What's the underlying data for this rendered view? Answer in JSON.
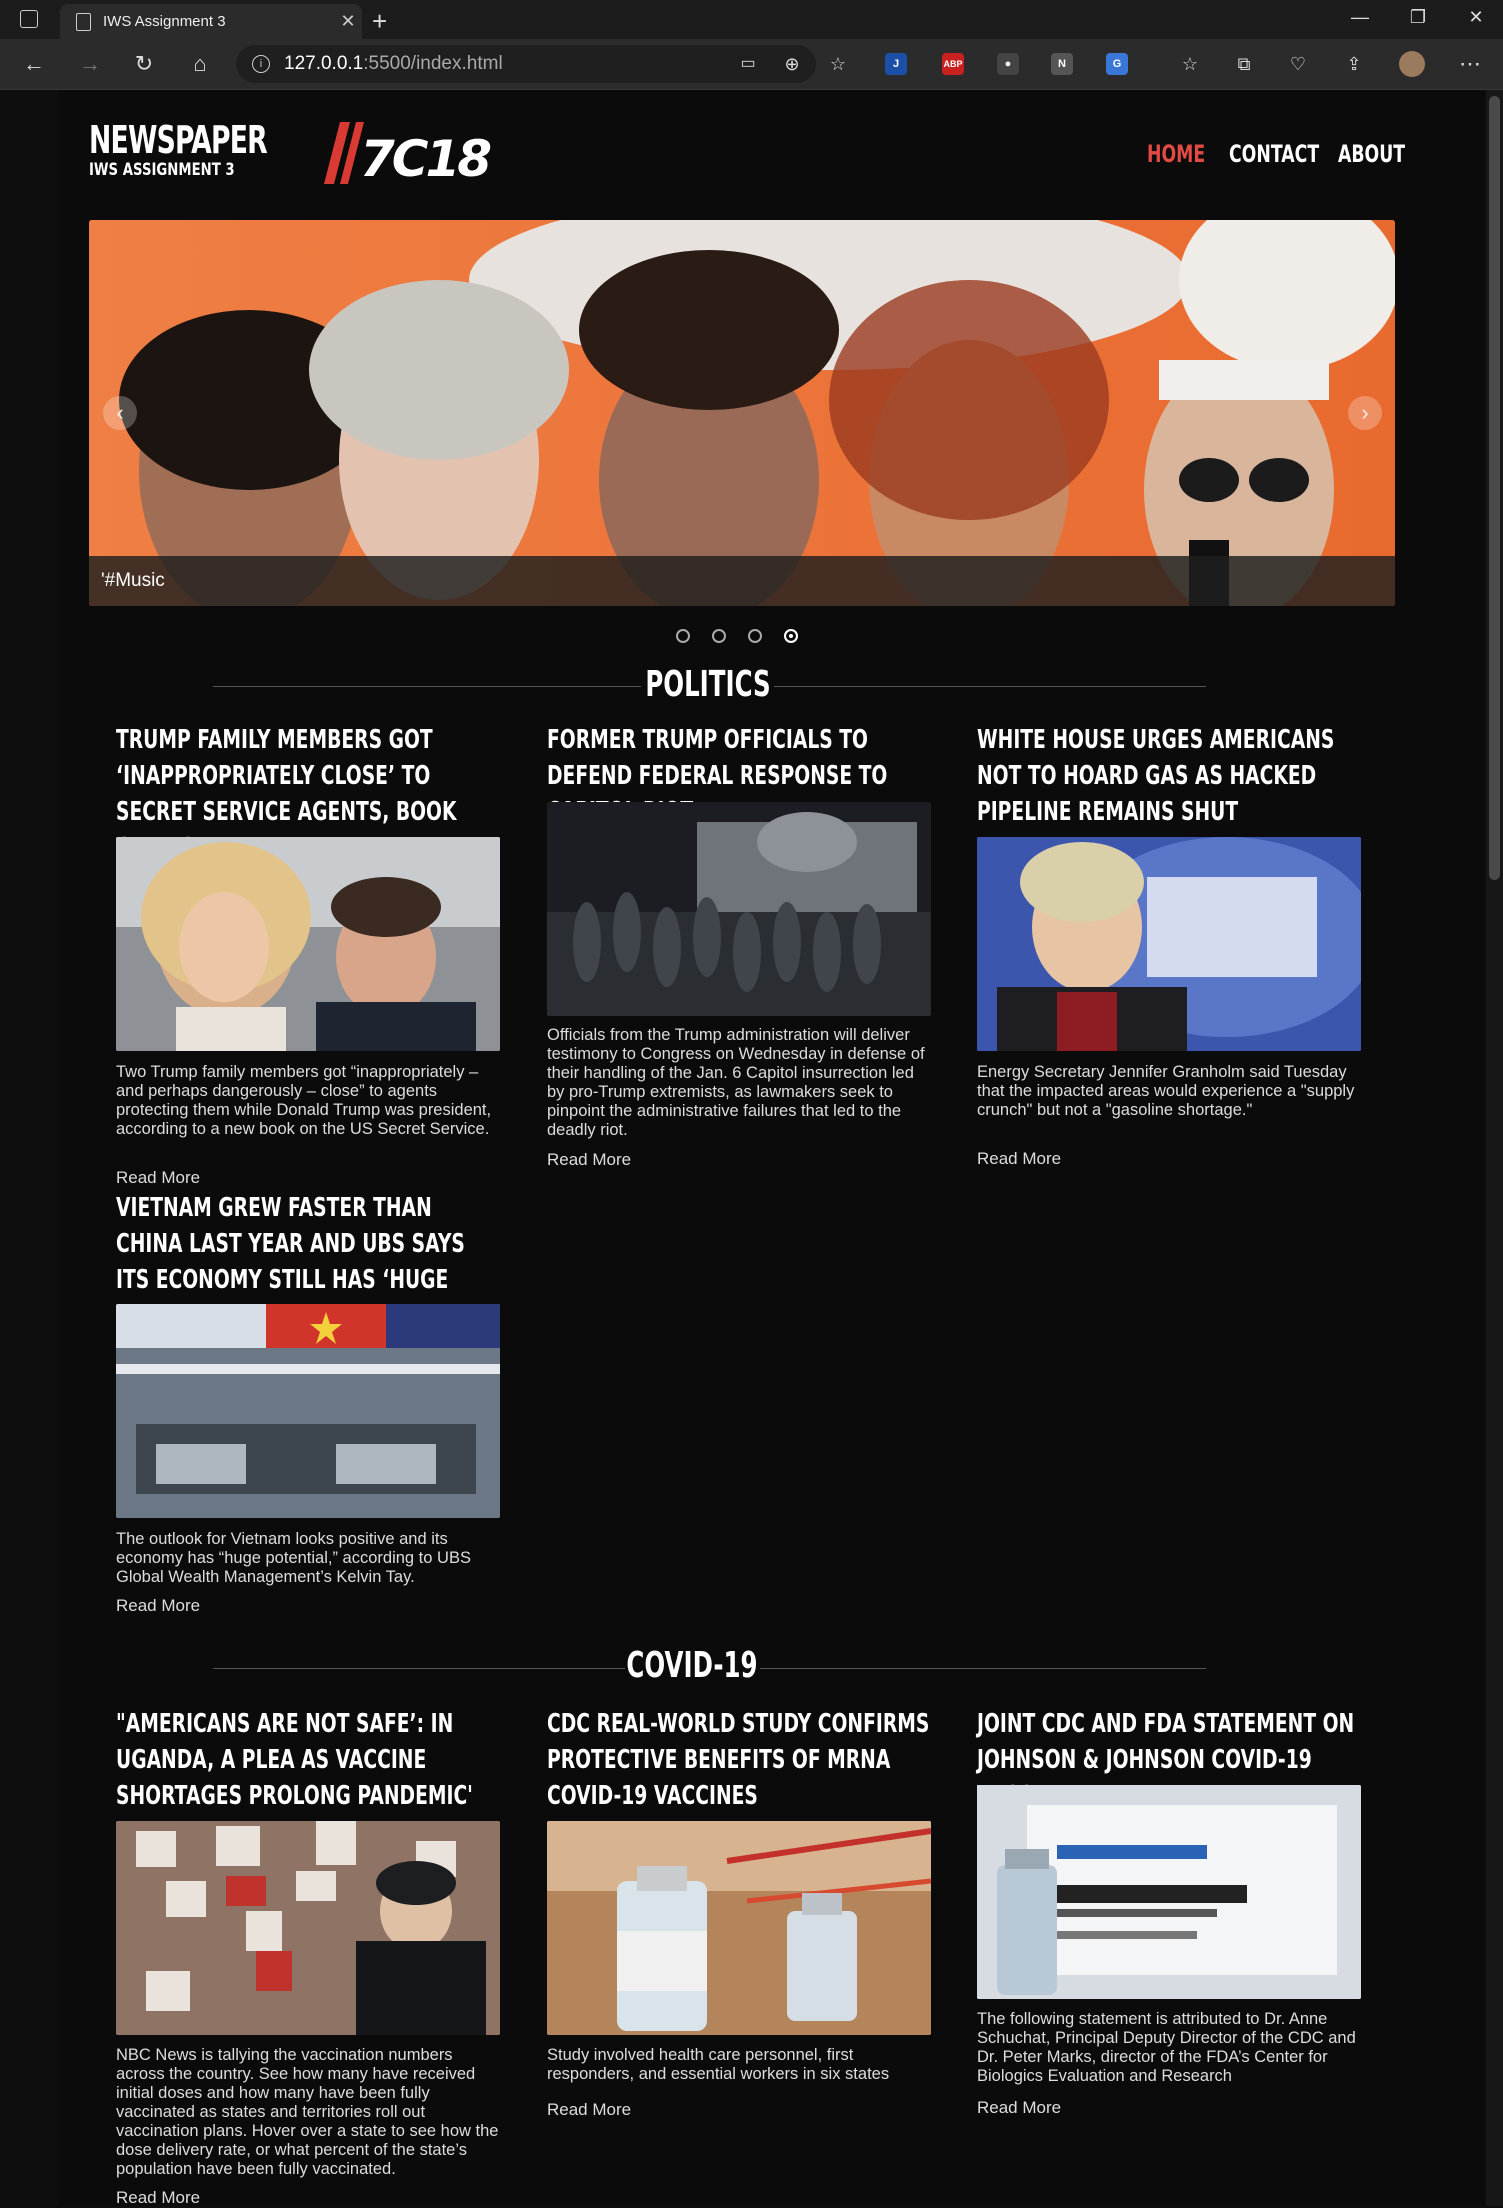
{
  "browser": {
    "tab_title": "IWS Assignment 3",
    "url_host": "127.0.0.1",
    "url_path": ":5500/index.html",
    "extensions": [
      "J",
      "ABP",
      "N"
    ]
  },
  "site": {
    "title": "NEWSPAPER",
    "subtitle": "IWS ASSIGNMENT 3",
    "logo_text": "7C18",
    "nav": [
      "HOME",
      "CONTACT",
      "ABOUT"
    ],
    "accent_color": "#e24b43"
  },
  "carousel": {
    "caption": "'#Music",
    "slide_count": 4,
    "active_index": 3
  },
  "sections": [
    {
      "title": "POLITICS",
      "articles": [
        {
          "headline": "Trump family members got ‘inappropriately close’ to Secret Service agents, book claims",
          "summary": "Two Trump family members got “inappropriately – and perhaps dangerously – close” to agents protecting them while Donald Trump was president, according to a new book on the US Secret Service.",
          "read_more": "Read More"
        },
        {
          "headline": "Former Trump officials to defend federal response to Capitol riot",
          "summary": "Officials from the Trump administration will deliver testimony to Congress on Wednesday in defense of their handling of the Jan. 6 Capitol insurrection led by pro-Trump extremists, as lawmakers seek to pinpoint the administrative failures that led to the deadly riot.",
          "read_more": "Read More"
        },
        {
          "headline": "White House urges Americans not to hoard gas as hacked pipeline remains shut",
          "summary": "Energy Secretary Jennifer Granholm said Tuesday that the impacted areas would experience a \"supply crunch\" but not a \"gasoline shortage.\"",
          "read_more": "Read More"
        },
        {
          "headline": "Vietnam grew faster than China last year and UBS says its economy still has ‘huge potential",
          "summary": "The outlook for Vietnam looks positive and its economy has “huge potential,” according to UBS Global Wealth Management’s Kelvin Tay.",
          "read_more": "Read More"
        }
      ]
    },
    {
      "title": "COVID-19",
      "articles": [
        {
          "headline": "\"Americans are not safe’: In Uganda, a plea as vaccine shortages prolong pandemic'",
          "summary": "NBC News is tallying the vaccination numbers across the country. See how many have received initial doses and how many have been fully vaccinated as states and territories roll out vaccination plans. Hover over a state to see how the dose delivery rate, or what percent of the state’s population have been fully vaccinated.",
          "read_more": "Read More"
        },
        {
          "headline": "CDC Real-World Study Confirms Protective Benefits of mRNA COVID-19 Vaccines",
          "summary": "Study involved health care personnel, first responders, and essential workers in six states",
          "read_more": "Read More"
        },
        {
          "headline": "Joint CDC and FDA Statement on Johnson & Johnson COVID-19 Vaccine",
          "summary": "The following statement is attributed to Dr. Anne Schuchat, Principal Deputy Director of the CDC and Dr. Peter Marks, director of the FDA’s Center for Biologics Evaluation and Research",
          "read_more": "Read More"
        }
      ]
    }
  ]
}
